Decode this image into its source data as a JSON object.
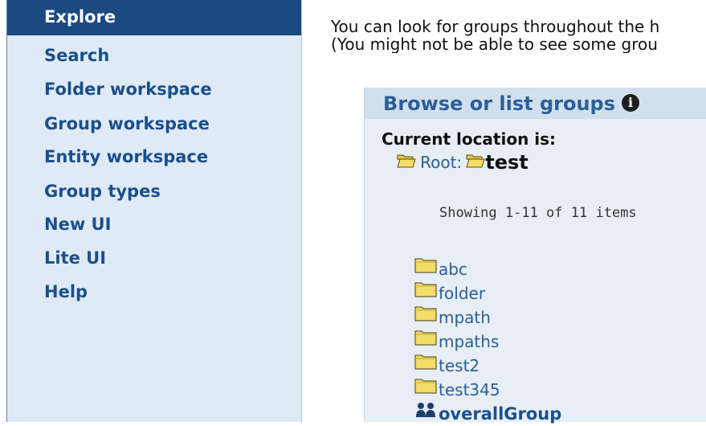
{
  "sidebar": {
    "items": [
      {
        "label": "Explore"
      },
      {
        "label": "Search"
      },
      {
        "label": "Folder workspace"
      },
      {
        "label": "Group workspace"
      },
      {
        "label": "Entity workspace"
      },
      {
        "label": "Group types"
      },
      {
        "label": "New UI"
      },
      {
        "label": "Lite UI"
      },
      {
        "label": "Help"
      }
    ]
  },
  "main": {
    "intro_line1": "You can look for groups throughout the h",
    "intro_line2": "(You might not be able to see some grou"
  },
  "panel": {
    "title": "Browse or list groups",
    "location_label": "Current location is:",
    "root_label": "Root:",
    "current_folder": "test",
    "status": "Showing 1-11 of 11 items",
    "items": [
      {
        "label": "abc",
        "icon": "folder-icon"
      },
      {
        "label": "folder",
        "icon": "folder-icon"
      },
      {
        "label": "mpath",
        "icon": "folder-icon"
      },
      {
        "label": "mpaths",
        "icon": "folder-icon"
      },
      {
        "label": "test2",
        "icon": "folder-icon"
      },
      {
        "label": "test345",
        "icon": "folder-icon"
      },
      {
        "label": "overallGroup",
        "icon": "group-icon"
      }
    ]
  }
}
